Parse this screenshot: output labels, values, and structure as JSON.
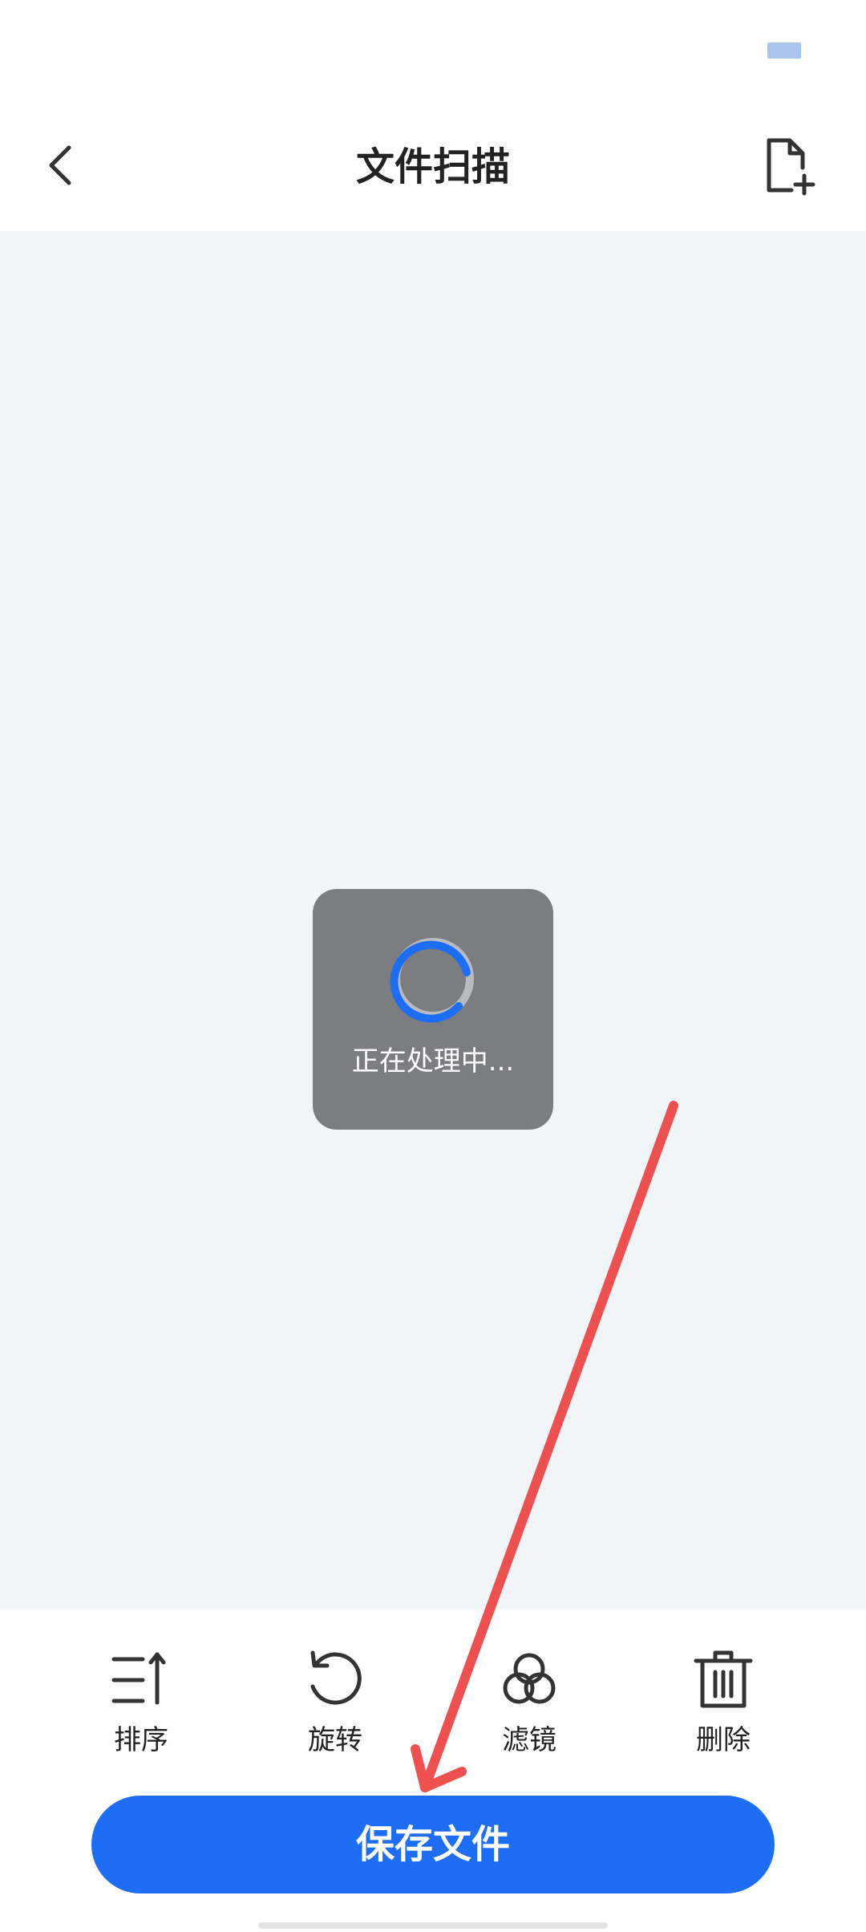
{
  "header": {
    "title": "文件扫描",
    "back_icon": "chevron-left-icon",
    "add_icon": "file-add-icon"
  },
  "loading": {
    "text": "正在处理中...",
    "spinner_color": "#1e6ef5",
    "spinner_track_color": "#b9bbbf"
  },
  "toolbar": {
    "items": [
      {
        "label": "排序",
        "icon": "sort-icon"
      },
      {
        "label": "旋转",
        "icon": "rotate-icon"
      },
      {
        "label": "滤镜",
        "icon": "filter-icon"
      },
      {
        "label": "删除",
        "icon": "trash-icon"
      }
    ]
  },
  "save_button": {
    "label": "保存文件"
  },
  "colors": {
    "accent": "#1e6ef5",
    "content_bg": "#f2f5f8",
    "toast_bg": "#7c7d80",
    "annotation_arrow": "#ee4f4f"
  }
}
